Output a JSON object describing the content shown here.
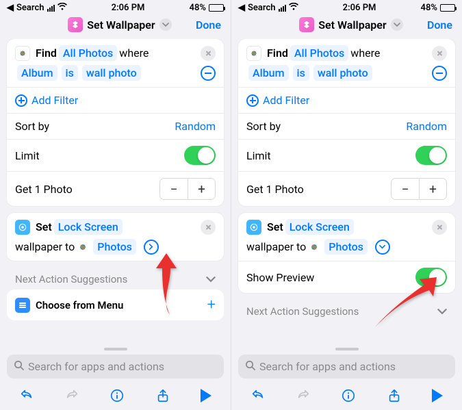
{
  "status": {
    "carrier": "Search",
    "time": "2:06 PM",
    "battery": "48%"
  },
  "header": {
    "title": "Set Wallpaper",
    "done": "Done"
  },
  "find": {
    "verb": "Find",
    "source": "All Photos",
    "where": "where",
    "field": "Album",
    "op": "is",
    "value": "wall photo",
    "add_filter": "Add Filter"
  },
  "sort": {
    "label": "Sort by",
    "value": "Random"
  },
  "limit": {
    "label": "Limit"
  },
  "get": {
    "label": "Get 1 Photo"
  },
  "setwall": {
    "verb": "Set",
    "target": "Lock Screen",
    "tail": "wallpaper to",
    "source": "Photos",
    "show_preview": "Show Preview"
  },
  "suggestions": {
    "header": "Next Action Suggestions",
    "item": "Choose from Menu"
  },
  "search": {
    "placeholder": "Search for apps and actions"
  }
}
